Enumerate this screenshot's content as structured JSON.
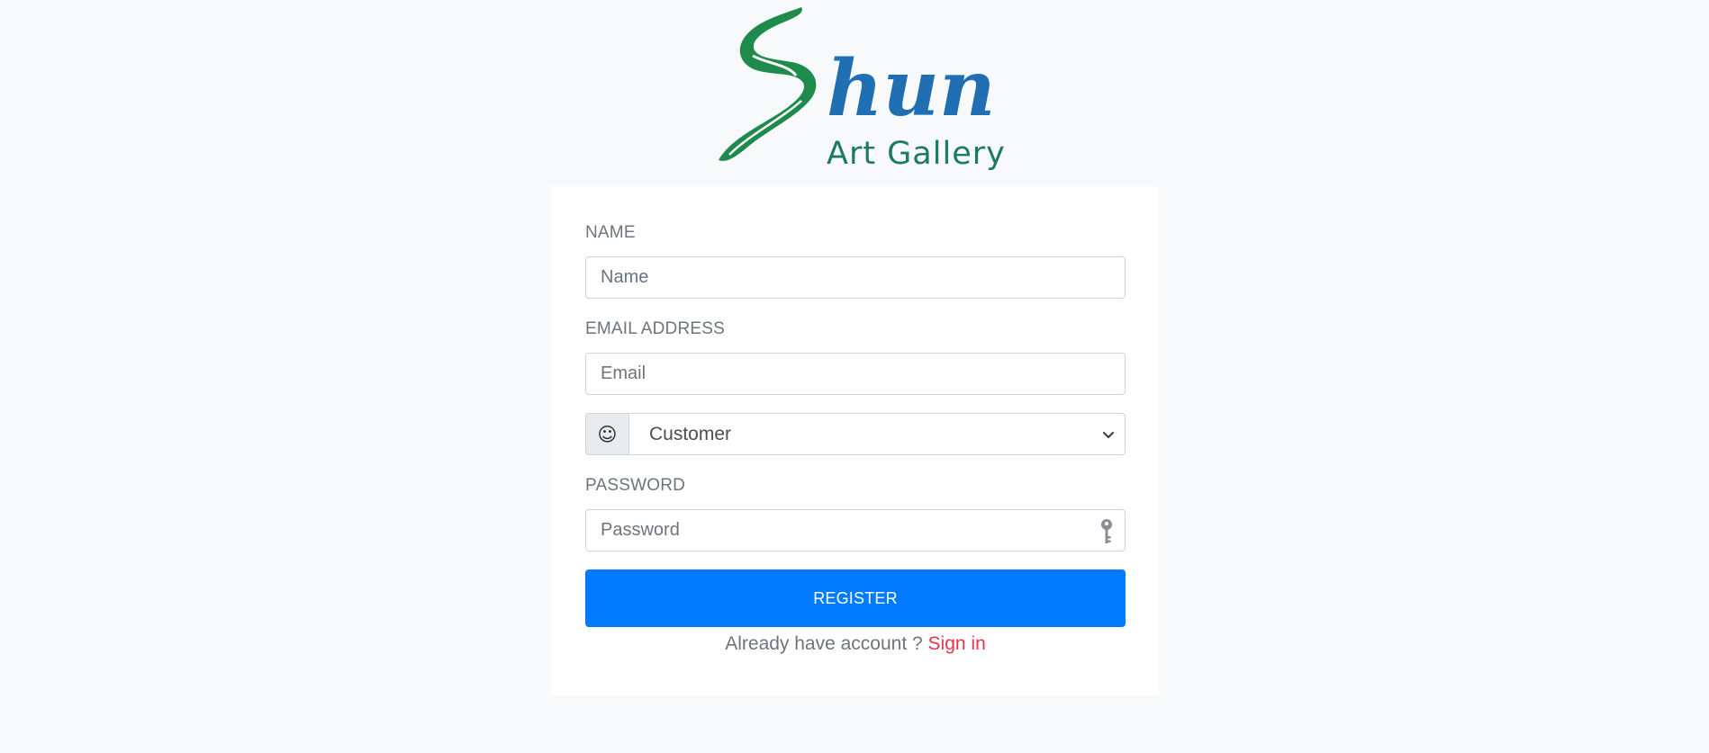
{
  "logo": {
    "wordmark": "Shun",
    "subtitle": "Art Gallery",
    "colors": {
      "s_stroke": "#1e8a4c",
      "hun": "#1f6fb2",
      "subtitle": "#1d7a63"
    }
  },
  "form": {
    "name_label": "NAME",
    "name_placeholder": "Name",
    "email_label": "EMAIL ADDRESS",
    "email_placeholder": "Email",
    "role_icon": "smiley-icon",
    "role_icon_glyph": "☺",
    "role_selected": "Customer",
    "password_label": "PASSWORD",
    "password_placeholder": "Password",
    "password_icon": "key-icon",
    "register_label": "REGISTER",
    "account_prompt": "Already have account ?",
    "signin_label": "Sign in"
  },
  "colors": {
    "page_bg": "#f7f9fa",
    "card_bg": "#ffffff",
    "primary": "#007bff",
    "link": "#e8334a",
    "muted_text": "#6c757d"
  }
}
